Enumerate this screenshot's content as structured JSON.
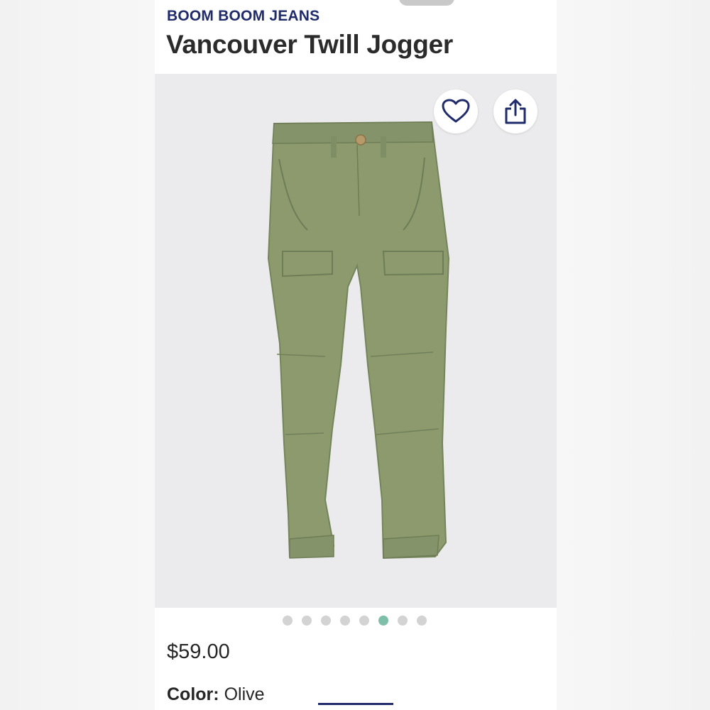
{
  "product": {
    "brand": "BOOM BOOM JEANS",
    "title": "Vancouver Twill Jogger",
    "price": "$59.00",
    "color_label": "Color:",
    "color_value": "Olive"
  },
  "gallery": {
    "image_count": 8,
    "active_index": 5,
    "actions": {
      "favorite_icon": "heart-outline-icon",
      "share_icon": "share-icon"
    }
  },
  "colors": {
    "brand_text": "#1f2b6b",
    "title_text": "#2b2b2b",
    "gallery_bg": "#ebebed",
    "pants_fill": "#8c9a6e",
    "active_dot": "#7dbfa8",
    "inactive_dot": "#d3d3d3"
  }
}
